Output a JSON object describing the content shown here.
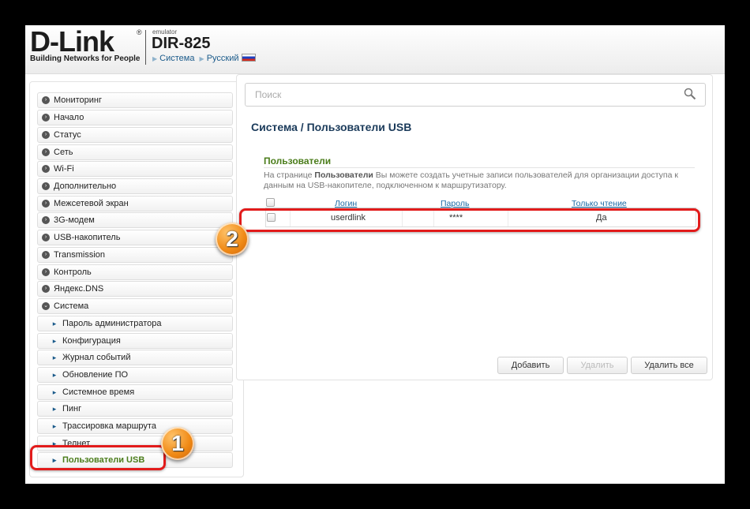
{
  "header": {
    "logo": "D-Link",
    "logo_tagline": "Building Networks for People",
    "emulator_label": "emulator",
    "model": "DIR-825",
    "breadcrumb": [
      "Система",
      "Русский"
    ]
  },
  "sidebar": {
    "items": [
      {
        "label": "Мониторинг"
      },
      {
        "label": "Начало"
      },
      {
        "label": "Статус"
      },
      {
        "label": "Сеть"
      },
      {
        "label": "Wi-Fi"
      },
      {
        "label": "Дополнительно"
      },
      {
        "label": "Межсетевой экран"
      },
      {
        "label": "3G-модем"
      },
      {
        "label": "USB-накопитель"
      },
      {
        "label": "Transmission"
      },
      {
        "label": "Контроль"
      },
      {
        "label": "Яндекс.DNS"
      },
      {
        "label": "Система"
      }
    ],
    "subitems": [
      {
        "label": "Пароль администратора"
      },
      {
        "label": "Конфигурация"
      },
      {
        "label": "Журнал событий"
      },
      {
        "label": "Обновление ПО"
      },
      {
        "label": "Системное время"
      },
      {
        "label": "Пинг"
      },
      {
        "label": "Трассировка маршрута"
      },
      {
        "label": "Телнет"
      },
      {
        "label": "Пользователи USB"
      }
    ]
  },
  "main": {
    "search_placeholder": "Поиск",
    "page_title": "Система /  Пользователи USB",
    "section_title": "Пользователи",
    "description_prefix": "На странице ",
    "description_bold": "Пользователи",
    "description_suffix": " Вы можете создать учетные записи пользователей для организации доступа к данным на USB-накопителе, подключенном к маршрутизатору.",
    "table": {
      "columns": [
        "Логин",
        "Пароль",
        "Только чтение"
      ],
      "rows": [
        {
          "login": "userdlink",
          "password": "****",
          "readonly": "Да"
        }
      ]
    },
    "buttons": {
      "add": "Добавить",
      "delete": "Удалить",
      "delete_all": "Удалить все"
    }
  },
  "annotations": {
    "badge1": "1",
    "badge2": "2",
    "highlight_color": "#e21b1b",
    "badge_color": "#f08a16"
  }
}
